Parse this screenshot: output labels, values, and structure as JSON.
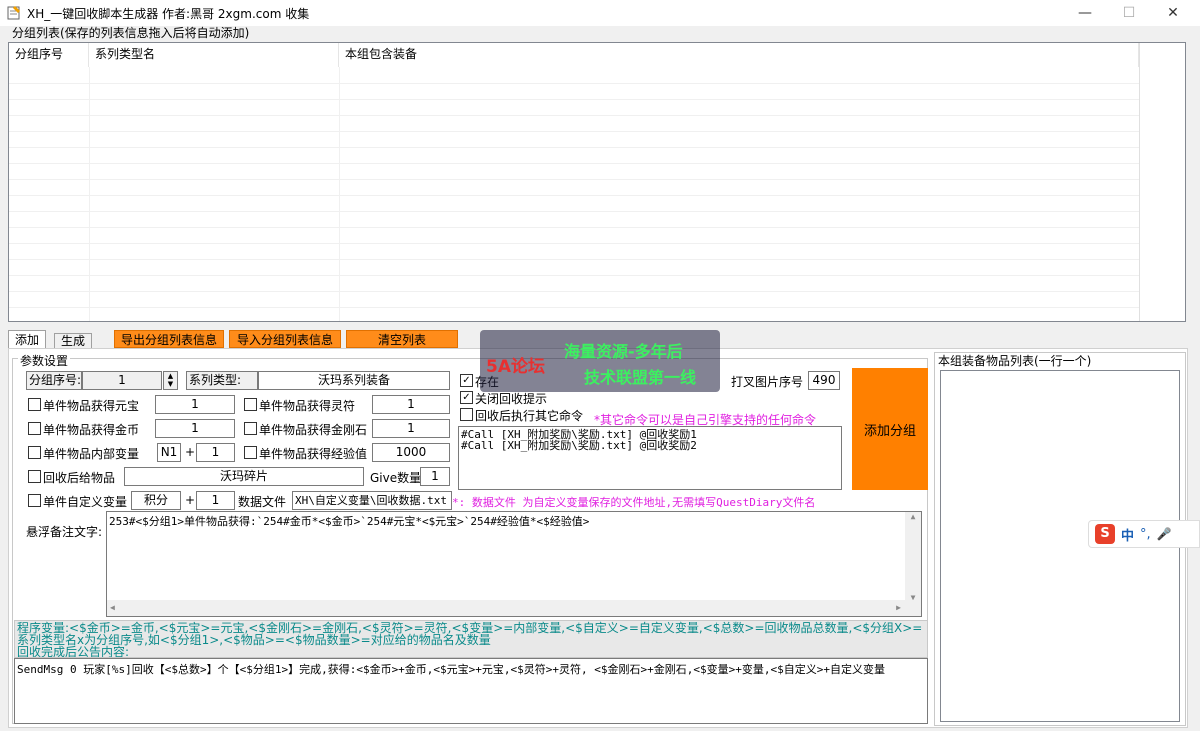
{
  "window": {
    "title": "XH_一键回收脚本生成器 作者:黑哥 2xgm.com 收集",
    "minimize": "—",
    "maximize": "☐",
    "close": "✕"
  },
  "group_list": {
    "label": "分组列表(保存的列表信息拖入后将自动添加)",
    "columns": [
      "分组序号",
      "系列类型名",
      "本组包含装备"
    ]
  },
  "tabs": [
    "添加",
    "生成"
  ],
  "toolbar": {
    "export": "导出分组列表信息",
    "import": "导入分组列表信息",
    "clear": "清空列表"
  },
  "params": {
    "title": "参数设置",
    "group_no_label": "分组序号:",
    "group_no_value": "1",
    "series_type_label": "系列类型:",
    "series_type_value": "沃玛系列装备",
    "yuanbao_label": "单件物品获得元宝",
    "yuanbao_value": "1",
    "lingfu_label": "单件物品获得灵符",
    "lingfu_value": "1",
    "gold_label": "单件物品获得金币",
    "gold_value": "1",
    "diamond_label": "单件物品获得金刚石",
    "diamond_value": "1",
    "var_label": "单件物品内部变量",
    "var_name": "N1",
    "var_plus": "+",
    "var_value": "1",
    "exp_label": "单件物品获得经验值",
    "exp_value": "1000",
    "give_item_label": "回收后给物品",
    "give_item_value": "沃玛碎片",
    "give_count_label": "Give数量",
    "give_count_value": "1",
    "custom_var_label": "单件自定义变量",
    "custom_var_name": "积分",
    "custom_var_plus": "+",
    "custom_var_value": "1",
    "data_file_label": "数据文件",
    "data_file_value": "XH\\自定义变量\\回收数据.txt",
    "data_file_note": "*: 数据文件 为自定义变量保存的文件地址,无需填写QuestDiary文件名",
    "store_label": "存在",
    "store_tail": "打叉图片序号",
    "store_value": "490",
    "close_tip_label": "关闭回收提示",
    "run_cmd_label": "回收后执行其它命令",
    "run_cmd_note": "*其它命令可以是自己引擎支持的任何命令",
    "commands": [
      "#Call [XH_附加奖励\\奖励.txt] @回收奖励1",
      "#Call [XH_附加奖励\\奖励.txt] @回收奖励2"
    ],
    "add_group": "添加分组",
    "float_note_label": "悬浮备注文字:",
    "float_note_value": "253#<$分组1>单件物品获得:`254#金币*<$金币>`254#元宝*<$元宝>`254#经验值*<$经验值>",
    "var_help": "程序变量:<$金币>=金币,<$元宝>=元宝,<$金刚石>=金刚石,<$灵符>=灵符,<$变量>=内部变量,<$自定义>=自定义变量,<$总数>=回收物品总数量,<$分组X>=系列类型名x为分组序号,如<$分组1>,<$物品>=<$物品数量>=对应给的物品名及数量",
    "announce_label": "回收完成后公告内容:",
    "announce_value": "SendMsg 0 玩家[%s]回收【<$总数>】个【<$分组1>】完成,获得:<$金币>+金币,<$元宝>+元宝,<$灵符>+灵符, <$金刚石>+金刚石,<$变量>+变量,<$自定义>+自定义变量"
  },
  "equip_list": {
    "label": "本组装备物品列表(一行一个)"
  },
  "watermark": {
    "logo": "5A论坛",
    "line1": "海量资源-多年后",
    "line2": "技术联盟第一线"
  },
  "ime": {
    "lang": "中",
    "punct": "°,",
    "mic": "🎤",
    "brand": "S"
  },
  "colors": {
    "orange_button": "#ff8c1a",
    "add_button": "#ff8000",
    "note_pink": "#e020e0",
    "help_teal": "#0a8a8a"
  }
}
